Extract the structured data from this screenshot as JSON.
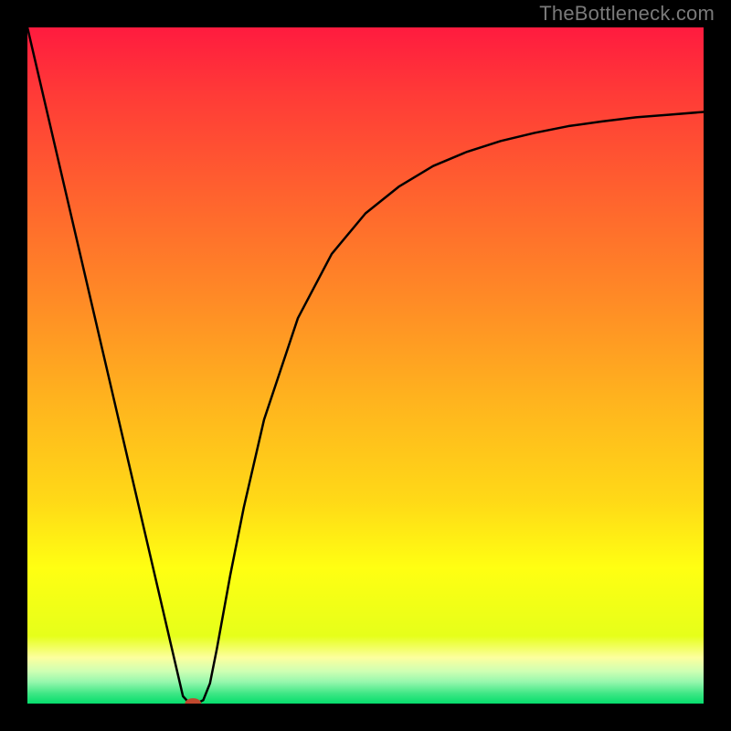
{
  "watermark": "TheBottleneck.com",
  "chart_data": {
    "type": "line",
    "title": "",
    "xlabel": "",
    "ylabel": "",
    "xlim": [
      0,
      100
    ],
    "ylim": [
      0,
      100
    ],
    "grid": false,
    "legend": false,
    "gradient_stops": [
      {
        "offset": 0,
        "color": "#ff1b3f"
      },
      {
        "offset": 0.1,
        "color": "#ff3b37"
      },
      {
        "offset": 0.25,
        "color": "#ff632e"
      },
      {
        "offset": 0.4,
        "color": "#ff8a26"
      },
      {
        "offset": 0.55,
        "color": "#ffb31e"
      },
      {
        "offset": 0.7,
        "color": "#ffd917"
      },
      {
        "offset": 0.8,
        "color": "#ffff12"
      },
      {
        "offset": 0.9,
        "color": "#e6ff1a"
      },
      {
        "offset": 0.932,
        "color": "#fcff9e"
      },
      {
        "offset": 0.952,
        "color": "#cfffb3"
      },
      {
        "offset": 0.968,
        "color": "#96f7ad"
      },
      {
        "offset": 0.985,
        "color": "#3fe785"
      },
      {
        "offset": 1.0,
        "color": "#06dd6c"
      }
    ],
    "series": [
      {
        "name": "curve",
        "x": [
          0,
          5,
          10,
          15,
          20,
          22,
          23,
          24,
          25,
          26,
          27,
          28,
          30,
          32,
          35,
          40,
          45,
          50,
          55,
          60,
          65,
          70,
          75,
          80,
          85,
          90,
          95,
          100
        ],
        "y": [
          100,
          78.5,
          57,
          35.5,
          14,
          5.4,
          1.1,
          0,
          0,
          0.5,
          3,
          8,
          19,
          29,
          42,
          57,
          66.5,
          72.5,
          76.5,
          79.5,
          81.6,
          83.2,
          84.4,
          85.4,
          86.1,
          86.7,
          87.1,
          87.5
        ]
      }
    ],
    "marker": {
      "x": 24.5,
      "y": 0,
      "rx": 1.2,
      "ry": 0.8,
      "color": "#c0482e"
    }
  }
}
